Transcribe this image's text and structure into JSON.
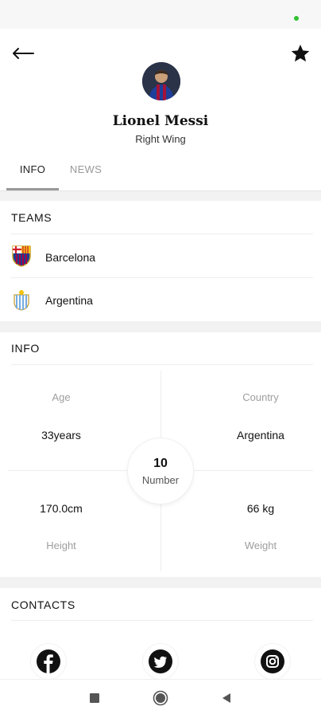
{
  "header": {
    "player_name": "Lionel Messi",
    "player_position": "Right Wing"
  },
  "tabs": [
    {
      "label": "INFO",
      "active": true
    },
    {
      "label": "NEWS",
      "active": false
    }
  ],
  "teams": {
    "title": "TEAMS",
    "items": [
      {
        "name": "Barcelona",
        "logo": "barcelona-crest-icon"
      },
      {
        "name": "Argentina",
        "logo": "argentina-crest-icon"
      }
    ]
  },
  "info": {
    "title": "INFO",
    "age": {
      "label": "Age",
      "value": "33years"
    },
    "country": {
      "label": "Country",
      "value": "Argentina"
    },
    "height": {
      "label": "Height",
      "value": "170.0cm"
    },
    "weight": {
      "label": "Weight",
      "value": "66 kg"
    },
    "number": {
      "label": "Number",
      "value": "10"
    }
  },
  "contacts": {
    "title": "CONTACTS",
    "items": [
      "facebook-icon",
      "twitter-icon",
      "instagram-icon"
    ]
  },
  "colors": {
    "accent_green": "#2fc12f",
    "text_primary": "#111111",
    "text_muted": "#9e9e9e"
  }
}
